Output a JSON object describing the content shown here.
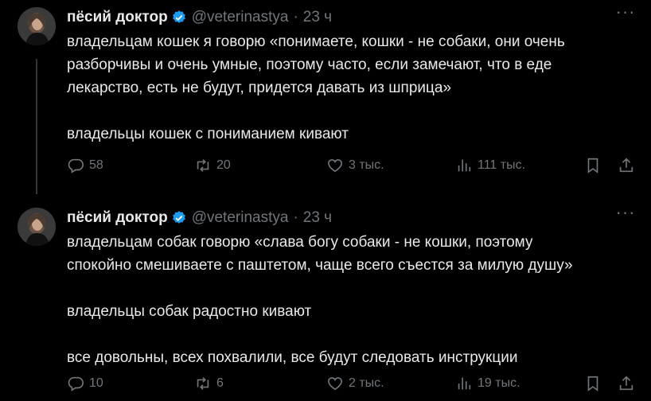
{
  "tweets": [
    {
      "name": "пёсий доктор",
      "handle": "@veterinastya",
      "time": "23 ч",
      "lines": [
        "владельцам кошек я говорю «понимаете, кошки - не собаки, они очень",
        "разборчивы и очень умные, поэтому часто, если замечают, что в еде",
        "лекарство, есть не будут, придется давать из шприца»",
        "",
        "владельцы кошек с пониманием кивают"
      ],
      "replies": "58",
      "retweets": "20",
      "likes": "3 тыс.",
      "views": "111 тыс."
    },
    {
      "name": "пёсий доктор",
      "handle": "@veterinastya",
      "time": "23 ч",
      "lines": [
        "владельцам собак говорю «слава богу собаки - не кошки, поэтому",
        "спокойно смешиваете с паштетом, чаще всего съестся за милую душу»",
        "",
        "владельцы собак радостно кивают",
        "",
        "все довольны, всех похвалили, все будут следовать инструкции"
      ],
      "replies": "10",
      "retweets": "6",
      "likes": "2 тыс.",
      "views": "19 тыс."
    }
  ],
  "icons": {
    "verified": "verified-badge-icon",
    "more": "more-icon",
    "reply": "reply-icon",
    "retweet": "retweet-icon",
    "like": "like-icon",
    "views": "views-icon",
    "bookmark": "bookmark-icon",
    "share": "share-icon"
  },
  "colors": {
    "background": "#000000",
    "text": "#e7e9ea",
    "secondary": "#71767b",
    "verified": "#1d9bf0"
  }
}
